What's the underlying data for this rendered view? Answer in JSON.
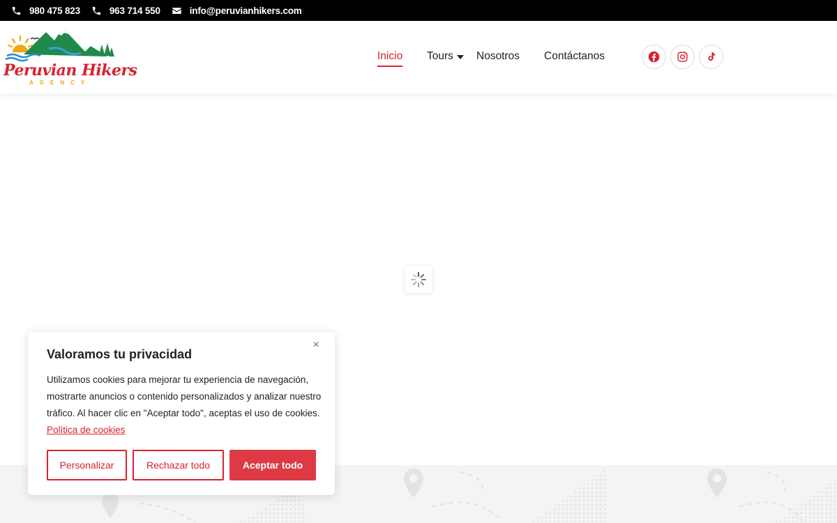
{
  "topbar": {
    "phone1": "980 475 823",
    "phone2": "963 714 550",
    "email": "info@peruvianhikers.com"
  },
  "logo": {
    "title": "Peruvian Hikers",
    "subtitle": "AGENCY"
  },
  "nav": {
    "items": [
      {
        "label": "Inicio",
        "active": true
      },
      {
        "label": "Tours",
        "has_dropdown": true
      },
      {
        "label": "Nosotros"
      },
      {
        "label": "Contáctanos"
      }
    ]
  },
  "social": {
    "icons": [
      "facebook-icon",
      "instagram-icon",
      "tiktok-icon"
    ]
  },
  "cookie": {
    "title": "Valoramos tu privacidad",
    "body": "Utilizamos cookies para mejorar tu experiencia de navegación, mostrarte anuncios o contenido personalizados y analizar nuestro tráfico. Al hacer clic en \"Aceptar todo\", aceptas el uso de cookies.",
    "link": "Política de cookies",
    "close": "×",
    "buttons": {
      "customize": "Personalizar",
      "reject": "Rechazar todo",
      "accept": "Aceptar todo"
    }
  },
  "colors": {
    "accent": "#d7222e",
    "topbar_bg": "#000000",
    "band_bg": "#f4f4f4"
  }
}
